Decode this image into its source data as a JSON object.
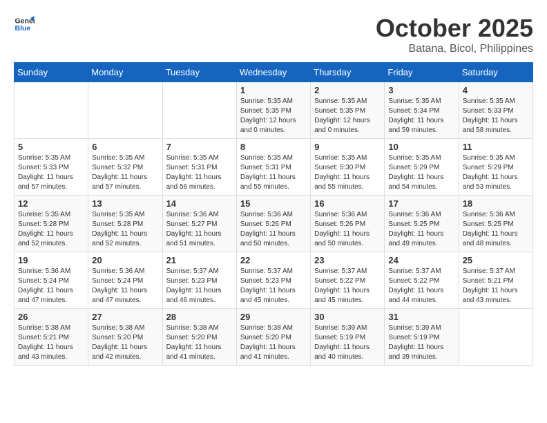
{
  "logo": {
    "general": "General",
    "blue": "Blue"
  },
  "title": {
    "month": "October 2025",
    "location": "Batana, Bicol, Philippines"
  },
  "headers": [
    "Sunday",
    "Monday",
    "Tuesday",
    "Wednesday",
    "Thursday",
    "Friday",
    "Saturday"
  ],
  "weeks": [
    [
      {
        "day": "",
        "info": ""
      },
      {
        "day": "",
        "info": ""
      },
      {
        "day": "",
        "info": ""
      },
      {
        "day": "1",
        "info": "Sunrise: 5:35 AM\nSunset: 5:35 PM\nDaylight: 12 hours\nand 0 minutes."
      },
      {
        "day": "2",
        "info": "Sunrise: 5:35 AM\nSunset: 5:35 PM\nDaylight: 12 hours\nand 0 minutes."
      },
      {
        "day": "3",
        "info": "Sunrise: 5:35 AM\nSunset: 5:34 PM\nDaylight: 11 hours\nand 59 minutes."
      },
      {
        "day": "4",
        "info": "Sunrise: 5:35 AM\nSunset: 5:33 PM\nDaylight: 11 hours\nand 58 minutes."
      }
    ],
    [
      {
        "day": "5",
        "info": "Sunrise: 5:35 AM\nSunset: 5:33 PM\nDaylight: 11 hours\nand 57 minutes."
      },
      {
        "day": "6",
        "info": "Sunrise: 5:35 AM\nSunset: 5:32 PM\nDaylight: 11 hours\nand 57 minutes."
      },
      {
        "day": "7",
        "info": "Sunrise: 5:35 AM\nSunset: 5:31 PM\nDaylight: 11 hours\nand 56 minutes."
      },
      {
        "day": "8",
        "info": "Sunrise: 5:35 AM\nSunset: 5:31 PM\nDaylight: 11 hours\nand 55 minutes."
      },
      {
        "day": "9",
        "info": "Sunrise: 5:35 AM\nSunset: 5:30 PM\nDaylight: 11 hours\nand 55 minutes."
      },
      {
        "day": "10",
        "info": "Sunrise: 5:35 AM\nSunset: 5:29 PM\nDaylight: 11 hours\nand 54 minutes."
      },
      {
        "day": "11",
        "info": "Sunrise: 5:35 AM\nSunset: 5:29 PM\nDaylight: 11 hours\nand 53 minutes."
      }
    ],
    [
      {
        "day": "12",
        "info": "Sunrise: 5:35 AM\nSunset: 5:28 PM\nDaylight: 11 hours\nand 52 minutes."
      },
      {
        "day": "13",
        "info": "Sunrise: 5:35 AM\nSunset: 5:28 PM\nDaylight: 11 hours\nand 52 minutes."
      },
      {
        "day": "14",
        "info": "Sunrise: 5:36 AM\nSunset: 5:27 PM\nDaylight: 11 hours\nand 51 minutes."
      },
      {
        "day": "15",
        "info": "Sunrise: 5:36 AM\nSunset: 5:26 PM\nDaylight: 11 hours\nand 50 minutes."
      },
      {
        "day": "16",
        "info": "Sunrise: 5:36 AM\nSunset: 5:26 PM\nDaylight: 11 hours\nand 50 minutes."
      },
      {
        "day": "17",
        "info": "Sunrise: 5:36 AM\nSunset: 5:25 PM\nDaylight: 11 hours\nand 49 minutes."
      },
      {
        "day": "18",
        "info": "Sunrise: 5:36 AM\nSunset: 5:25 PM\nDaylight: 11 hours\nand 48 minutes."
      }
    ],
    [
      {
        "day": "19",
        "info": "Sunrise: 5:36 AM\nSunset: 5:24 PM\nDaylight: 11 hours\nand 47 minutes."
      },
      {
        "day": "20",
        "info": "Sunrise: 5:36 AM\nSunset: 5:24 PM\nDaylight: 11 hours\nand 47 minutes."
      },
      {
        "day": "21",
        "info": "Sunrise: 5:37 AM\nSunset: 5:23 PM\nDaylight: 11 hours\nand 46 minutes."
      },
      {
        "day": "22",
        "info": "Sunrise: 5:37 AM\nSunset: 5:23 PM\nDaylight: 11 hours\nand 45 minutes."
      },
      {
        "day": "23",
        "info": "Sunrise: 5:37 AM\nSunset: 5:22 PM\nDaylight: 11 hours\nand 45 minutes."
      },
      {
        "day": "24",
        "info": "Sunrise: 5:37 AM\nSunset: 5:22 PM\nDaylight: 11 hours\nand 44 minutes."
      },
      {
        "day": "25",
        "info": "Sunrise: 5:37 AM\nSunset: 5:21 PM\nDaylight: 11 hours\nand 43 minutes."
      }
    ],
    [
      {
        "day": "26",
        "info": "Sunrise: 5:38 AM\nSunset: 5:21 PM\nDaylight: 11 hours\nand 43 minutes."
      },
      {
        "day": "27",
        "info": "Sunrise: 5:38 AM\nSunset: 5:20 PM\nDaylight: 11 hours\nand 42 minutes."
      },
      {
        "day": "28",
        "info": "Sunrise: 5:38 AM\nSunset: 5:20 PM\nDaylight: 11 hours\nand 41 minutes."
      },
      {
        "day": "29",
        "info": "Sunrise: 5:38 AM\nSunset: 5:20 PM\nDaylight: 11 hours\nand 41 minutes."
      },
      {
        "day": "30",
        "info": "Sunrise: 5:39 AM\nSunset: 5:19 PM\nDaylight: 11 hours\nand 40 minutes."
      },
      {
        "day": "31",
        "info": "Sunrise: 5:39 AM\nSunset: 5:19 PM\nDaylight: 11 hours\nand 39 minutes."
      },
      {
        "day": "",
        "info": ""
      }
    ]
  ]
}
